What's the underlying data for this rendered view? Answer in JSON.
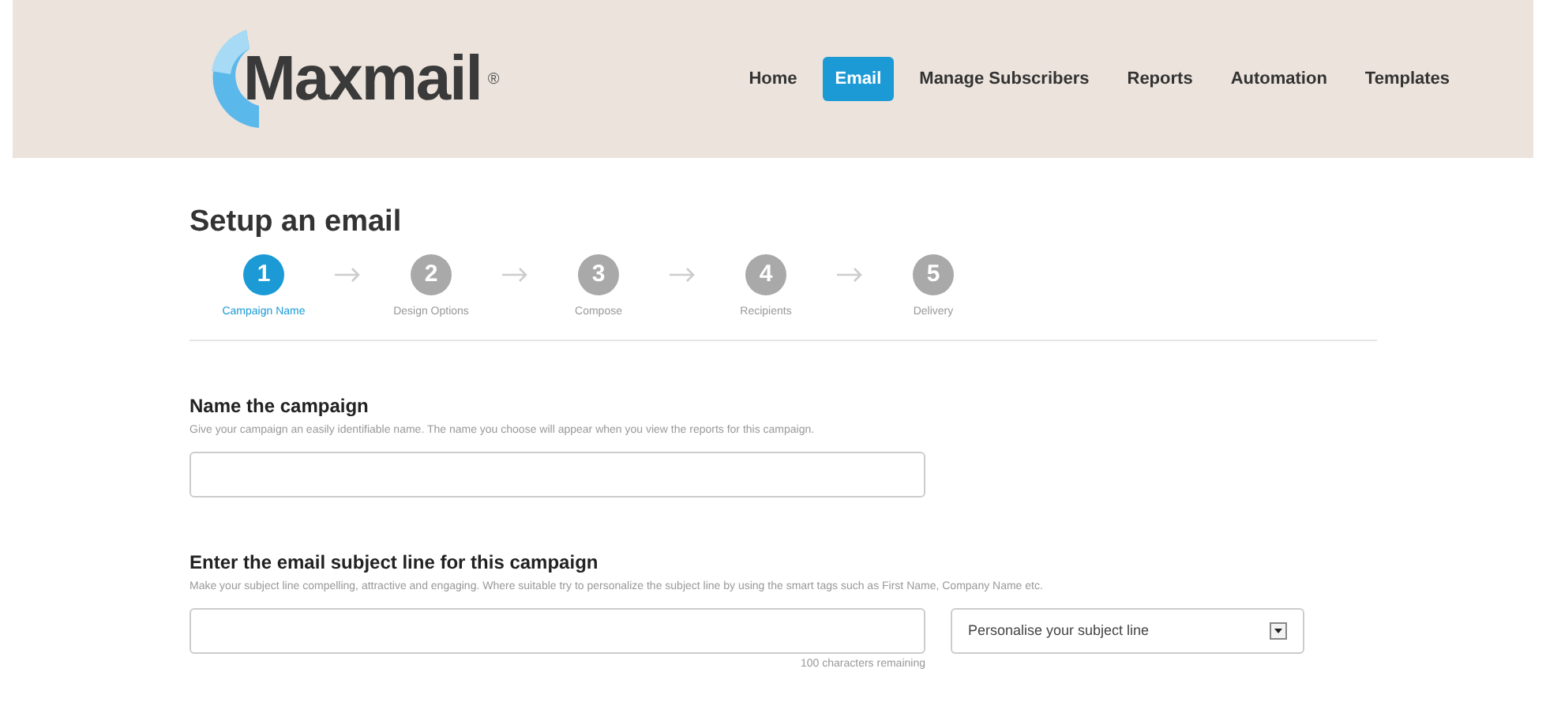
{
  "logo": {
    "text": "Maxmail",
    "mark": "®"
  },
  "nav": [
    {
      "label": "Home",
      "selected": false
    },
    {
      "label": "Email",
      "selected": true
    },
    {
      "label": "Manage Subscribers",
      "selected": false
    },
    {
      "label": "Reports",
      "selected": false
    },
    {
      "label": "Automation",
      "selected": false
    },
    {
      "label": "Templates",
      "selected": false
    }
  ],
  "page_title": "Setup an email",
  "steps": [
    {
      "number": "1",
      "label": "Campaign Name",
      "selected": true
    },
    {
      "number": "2",
      "label": "Design Options",
      "selected": false
    },
    {
      "number": "3",
      "label": "Compose",
      "selected": false
    },
    {
      "number": "4",
      "label": "Recipients",
      "selected": false
    },
    {
      "number": "5",
      "label": "Delivery",
      "selected": false
    }
  ],
  "sections": [
    {
      "heading": "Name the campaign",
      "hint": "Give your campaign an easily identifiable name. The name you choose will appear when you view the reports for this campaign."
    },
    {
      "heading": "Enter the email subject line for this campaign",
      "hint": "Make your subject line compelling, attractive and engaging. Where suitable try to personalize the subject line by using the smart tags such as First Name, Company Name etc.",
      "dropdown": "Personalise your subject line",
      "counter": "100 characters remaining"
    }
  ]
}
